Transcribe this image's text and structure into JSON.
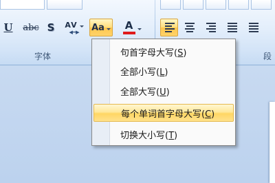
{
  "ribbon": {
    "font_group_label": "字体",
    "paragraph_group_label": "段",
    "buttons": {
      "underline": "U",
      "strikethrough": "abc",
      "shadow": "S",
      "char_spacing": "AV",
      "change_case": "Aa",
      "font_color": "A"
    },
    "font_color_hex": "#e01b1b"
  },
  "change_case_menu": {
    "items": [
      {
        "label": "句首字母大写",
        "accel": "S"
      },
      {
        "label": "全部小写",
        "accel": "L"
      },
      {
        "label": "全部大写",
        "accel": "U"
      },
      {
        "label": "每个单词首字母大写",
        "accel": "C"
      },
      {
        "label": "切换大小写",
        "accel": "T"
      }
    ],
    "highlighted_index": 3
  }
}
